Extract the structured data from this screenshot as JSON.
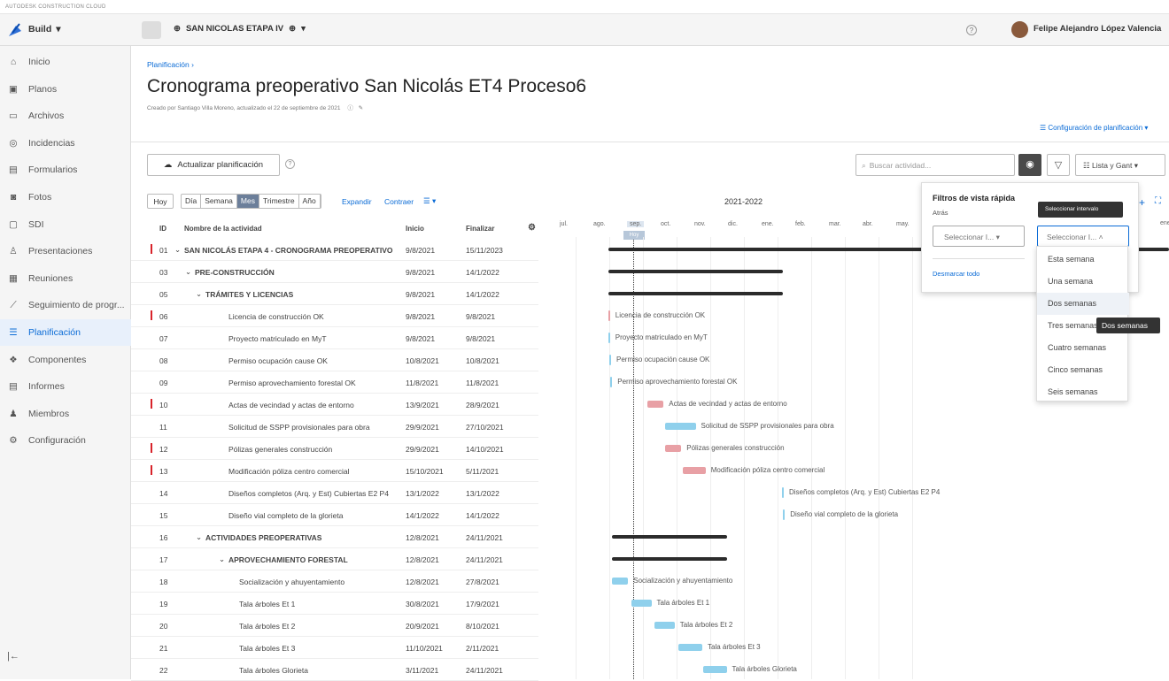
{
  "app": {
    "brand_strip": "AUTODESK CONSTRUCTION CLOUD",
    "module": "Build",
    "project": "SAN NICOLAS ETAPA IV",
    "user": "Felipe Alejandro López Valencia"
  },
  "sidebar": {
    "items": [
      {
        "label": "Inicio",
        "icon": "home-icon"
      },
      {
        "label": "Planos",
        "icon": "sheets-icon"
      },
      {
        "label": "Archivos",
        "icon": "file-icon"
      },
      {
        "label": "Incidencias",
        "icon": "issue-icon"
      },
      {
        "label": "Formularios",
        "icon": "forms-icon"
      },
      {
        "label": "Fotos",
        "icon": "photo-icon"
      },
      {
        "label": "SDI",
        "icon": "rfi-icon"
      },
      {
        "label": "Presentaciones",
        "icon": "submittal-icon"
      },
      {
        "label": "Reuniones",
        "icon": "meeting-icon"
      },
      {
        "label": "Seguimiento de progr...",
        "icon": "progress-icon"
      },
      {
        "label": "Planificación",
        "icon": "schedule-icon"
      },
      {
        "label": "Componentes",
        "icon": "components-icon"
      },
      {
        "label": "Informes",
        "icon": "reports-icon"
      },
      {
        "label": "Miembros",
        "icon": "members-icon"
      },
      {
        "label": "Configuración",
        "icon": "settings-icon"
      }
    ]
  },
  "header": {
    "breadcrumb": "Planificación",
    "title": "Cronograma preoperativo San Nicolás ET4 Proceso6",
    "subtitle": "Creado por Santiago Villa Moreno, actualizado el 22 de septiembre de 2021",
    "config_link": "Configuración de planificación",
    "update_button": "Actualizar planificación",
    "search_placeholder": "Buscar actividad...",
    "view_select": "Lista y Gant"
  },
  "toolbar": {
    "hoy": "Hoy",
    "scales": [
      "Día",
      "Semana",
      "Mes",
      "Trimestre",
      "Año"
    ],
    "active_scale": "Mes",
    "expandir": "Expandir",
    "contraer": "Contraer"
  },
  "table": {
    "headers": {
      "id": "ID",
      "name": "Nombre de la actividad",
      "start": "Inicio",
      "end": "Finalizar"
    },
    "rows": [
      {
        "id": "01",
        "name": "SAN NICOLÁS ETAPA 4 - CRONOGRAMA PREOPERATIVO",
        "start": "9/8/2021",
        "end": "15/11/2023",
        "level": 0,
        "group": true,
        "flag": true
      },
      {
        "id": "03",
        "name": "PRE-CONSTRUCCIÓN",
        "start": "9/8/2021",
        "end": "14/1/2022",
        "level": 1,
        "group": true,
        "flag": false
      },
      {
        "id": "05",
        "name": "TRÁMITES Y LICENCIAS",
        "start": "9/8/2021",
        "end": "14/1/2022",
        "level": 2,
        "group": true,
        "flag": false
      },
      {
        "id": "06",
        "name": "Licencia de construcción OK",
        "start": "9/8/2021",
        "end": "9/8/2021",
        "level": 3,
        "group": false,
        "flag": true
      },
      {
        "id": "07",
        "name": "Proyecto matriculado en MyT",
        "start": "9/8/2021",
        "end": "9/8/2021",
        "level": 3,
        "group": false,
        "flag": false
      },
      {
        "id": "08",
        "name": "Permiso ocupación cause OK",
        "start": "10/8/2021",
        "end": "10/8/2021",
        "level": 3,
        "group": false,
        "flag": false
      },
      {
        "id": "09",
        "name": "Permiso aprovechamiento forestal OK",
        "start": "11/8/2021",
        "end": "11/8/2021",
        "level": 3,
        "group": false,
        "flag": false
      },
      {
        "id": "10",
        "name": "Actas de vecindad y actas de entorno",
        "start": "13/9/2021",
        "end": "28/9/2021",
        "level": 3,
        "group": false,
        "flag": true
      },
      {
        "id": "11",
        "name": "Solicitud de SSPP provisionales para obra",
        "start": "29/9/2021",
        "end": "27/10/2021",
        "level": 3,
        "group": false,
        "flag": false
      },
      {
        "id": "12",
        "name": "Pólizas generales construcción",
        "start": "29/9/2021",
        "end": "14/10/2021",
        "level": 3,
        "group": false,
        "flag": true
      },
      {
        "id": "13",
        "name": "Modificación póliza centro comercial",
        "start": "15/10/2021",
        "end": "5/11/2021",
        "level": 3,
        "group": false,
        "flag": true
      },
      {
        "id": "14",
        "name": "Diseños completos (Arq. y Est) Cubiertas E2 P4",
        "start": "13/1/2022",
        "end": "13/1/2022",
        "level": 3,
        "group": false,
        "flag": false
      },
      {
        "id": "15",
        "name": "Diseño vial completo de la glorieta",
        "start": "14/1/2022",
        "end": "14/1/2022",
        "level": 3,
        "group": false,
        "flag": false
      },
      {
        "id": "16",
        "name": "ACTIVIDADES PREOPERATIVAS",
        "start": "12/8/2021",
        "end": "24/11/2021",
        "level": 2,
        "group": true,
        "flag": false
      },
      {
        "id": "17",
        "name": "APROVECHAMIENTO FORESTAL",
        "start": "12/8/2021",
        "end": "24/11/2021",
        "level": 3,
        "group": true,
        "flag": false
      },
      {
        "id": "18",
        "name": "Socialización y ahuyentamiento",
        "start": "12/8/2021",
        "end": "27/8/2021",
        "level": 4,
        "group": false,
        "flag": false
      },
      {
        "id": "19",
        "name": "Tala árboles Et 1",
        "start": "30/8/2021",
        "end": "17/9/2021",
        "level": 4,
        "group": false,
        "flag": false
      },
      {
        "id": "20",
        "name": "Tala árboles Et 2",
        "start": "20/9/2021",
        "end": "8/10/2021",
        "level": 4,
        "group": false,
        "flag": false
      },
      {
        "id": "21",
        "name": "Tala árboles Et 3",
        "start": "11/10/2021",
        "end": "2/11/2021",
        "level": 4,
        "group": false,
        "flag": false
      },
      {
        "id": "22",
        "name": "Tala árboles Glorieta",
        "start": "3/11/2021",
        "end": "24/11/2021",
        "level": 4,
        "group": false,
        "flag": false
      }
    ]
  },
  "gantt": {
    "year_label": "2021-2022",
    "months": [
      "jul.",
      "ago.",
      "sep.",
      "oct.",
      "nov.",
      "dic.",
      "ene.",
      "feb.",
      "mar.",
      "abr.",
      "may."
    ],
    "today_label": "Hoy",
    "colors": {
      "group": "#2b2b2b",
      "critical": "#e8a0a5",
      "normal": "#8fd0ec"
    }
  },
  "filters_panel": {
    "title": "Filtros de vista rápida",
    "atras": "Atrás",
    "left_select": "Seleccionar I...",
    "right_select": "Seleccionar I...",
    "clear_all": "Desmarcar todo",
    "tooltip": "Seleccionar intervalo",
    "options": [
      "Esta semana",
      "Una semana",
      "Dos semanas",
      "Tres semanas",
      "Cuatro semanas",
      "Cinco semanas",
      "Seis semanas"
    ],
    "hovered": "Dos semanas",
    "hover_tooltip": "Dos semanas"
  }
}
